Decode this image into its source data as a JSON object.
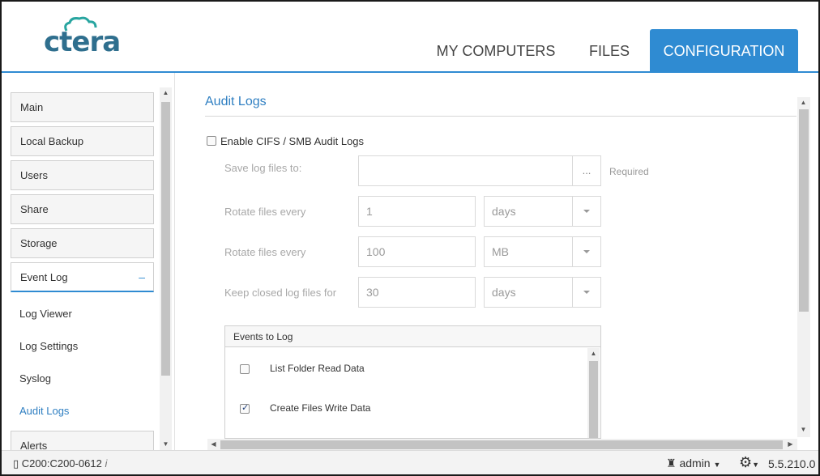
{
  "brand": {
    "logo_text": "ctera"
  },
  "nav": {
    "tabs": [
      {
        "label": "MY COMPUTERS"
      },
      {
        "label": "FILES"
      },
      {
        "label": "CONFIGURATION"
      }
    ],
    "active": "CONFIGURATION"
  },
  "sidebar": {
    "items": [
      {
        "label": "Main"
      },
      {
        "label": "Local Backup"
      },
      {
        "label": "Users"
      },
      {
        "label": "Share"
      },
      {
        "label": "Storage"
      },
      {
        "label": "Event Log",
        "toggle": "–"
      },
      {
        "label": "Alerts"
      }
    ],
    "subitems": [
      {
        "label": "Log Viewer"
      },
      {
        "label": "Log Settings"
      },
      {
        "label": "Syslog"
      },
      {
        "label": "Audit Logs"
      }
    ],
    "active_subitem": "Audit Logs"
  },
  "main": {
    "title": "Audit Logs",
    "enable_checkbox": {
      "label": "Enable CIFS / SMB Audit Logs",
      "checked": false
    },
    "save_log": {
      "label": "Save log files to:",
      "value": "",
      "browse": "...",
      "hint": "Required"
    },
    "rotate_time": {
      "label": "Rotate files every",
      "value": "1",
      "unit": "days"
    },
    "rotate_size": {
      "label": "Rotate files every",
      "value": "100",
      "unit": "MB"
    },
    "keep_closed": {
      "label": "Keep closed log files for",
      "value": "30",
      "unit": "days"
    },
    "events": {
      "header": "Events to Log",
      "items": [
        {
          "label": "List Folder Read Data",
          "checked": false
        },
        {
          "label": "Create Files Write Data",
          "checked": true
        }
      ]
    }
  },
  "footer": {
    "device": "C200:C200-0612",
    "user": "admin",
    "version": "5.5.210.0"
  },
  "colors": {
    "accent": "#2f8bd2",
    "link": "#2f7fc2"
  }
}
